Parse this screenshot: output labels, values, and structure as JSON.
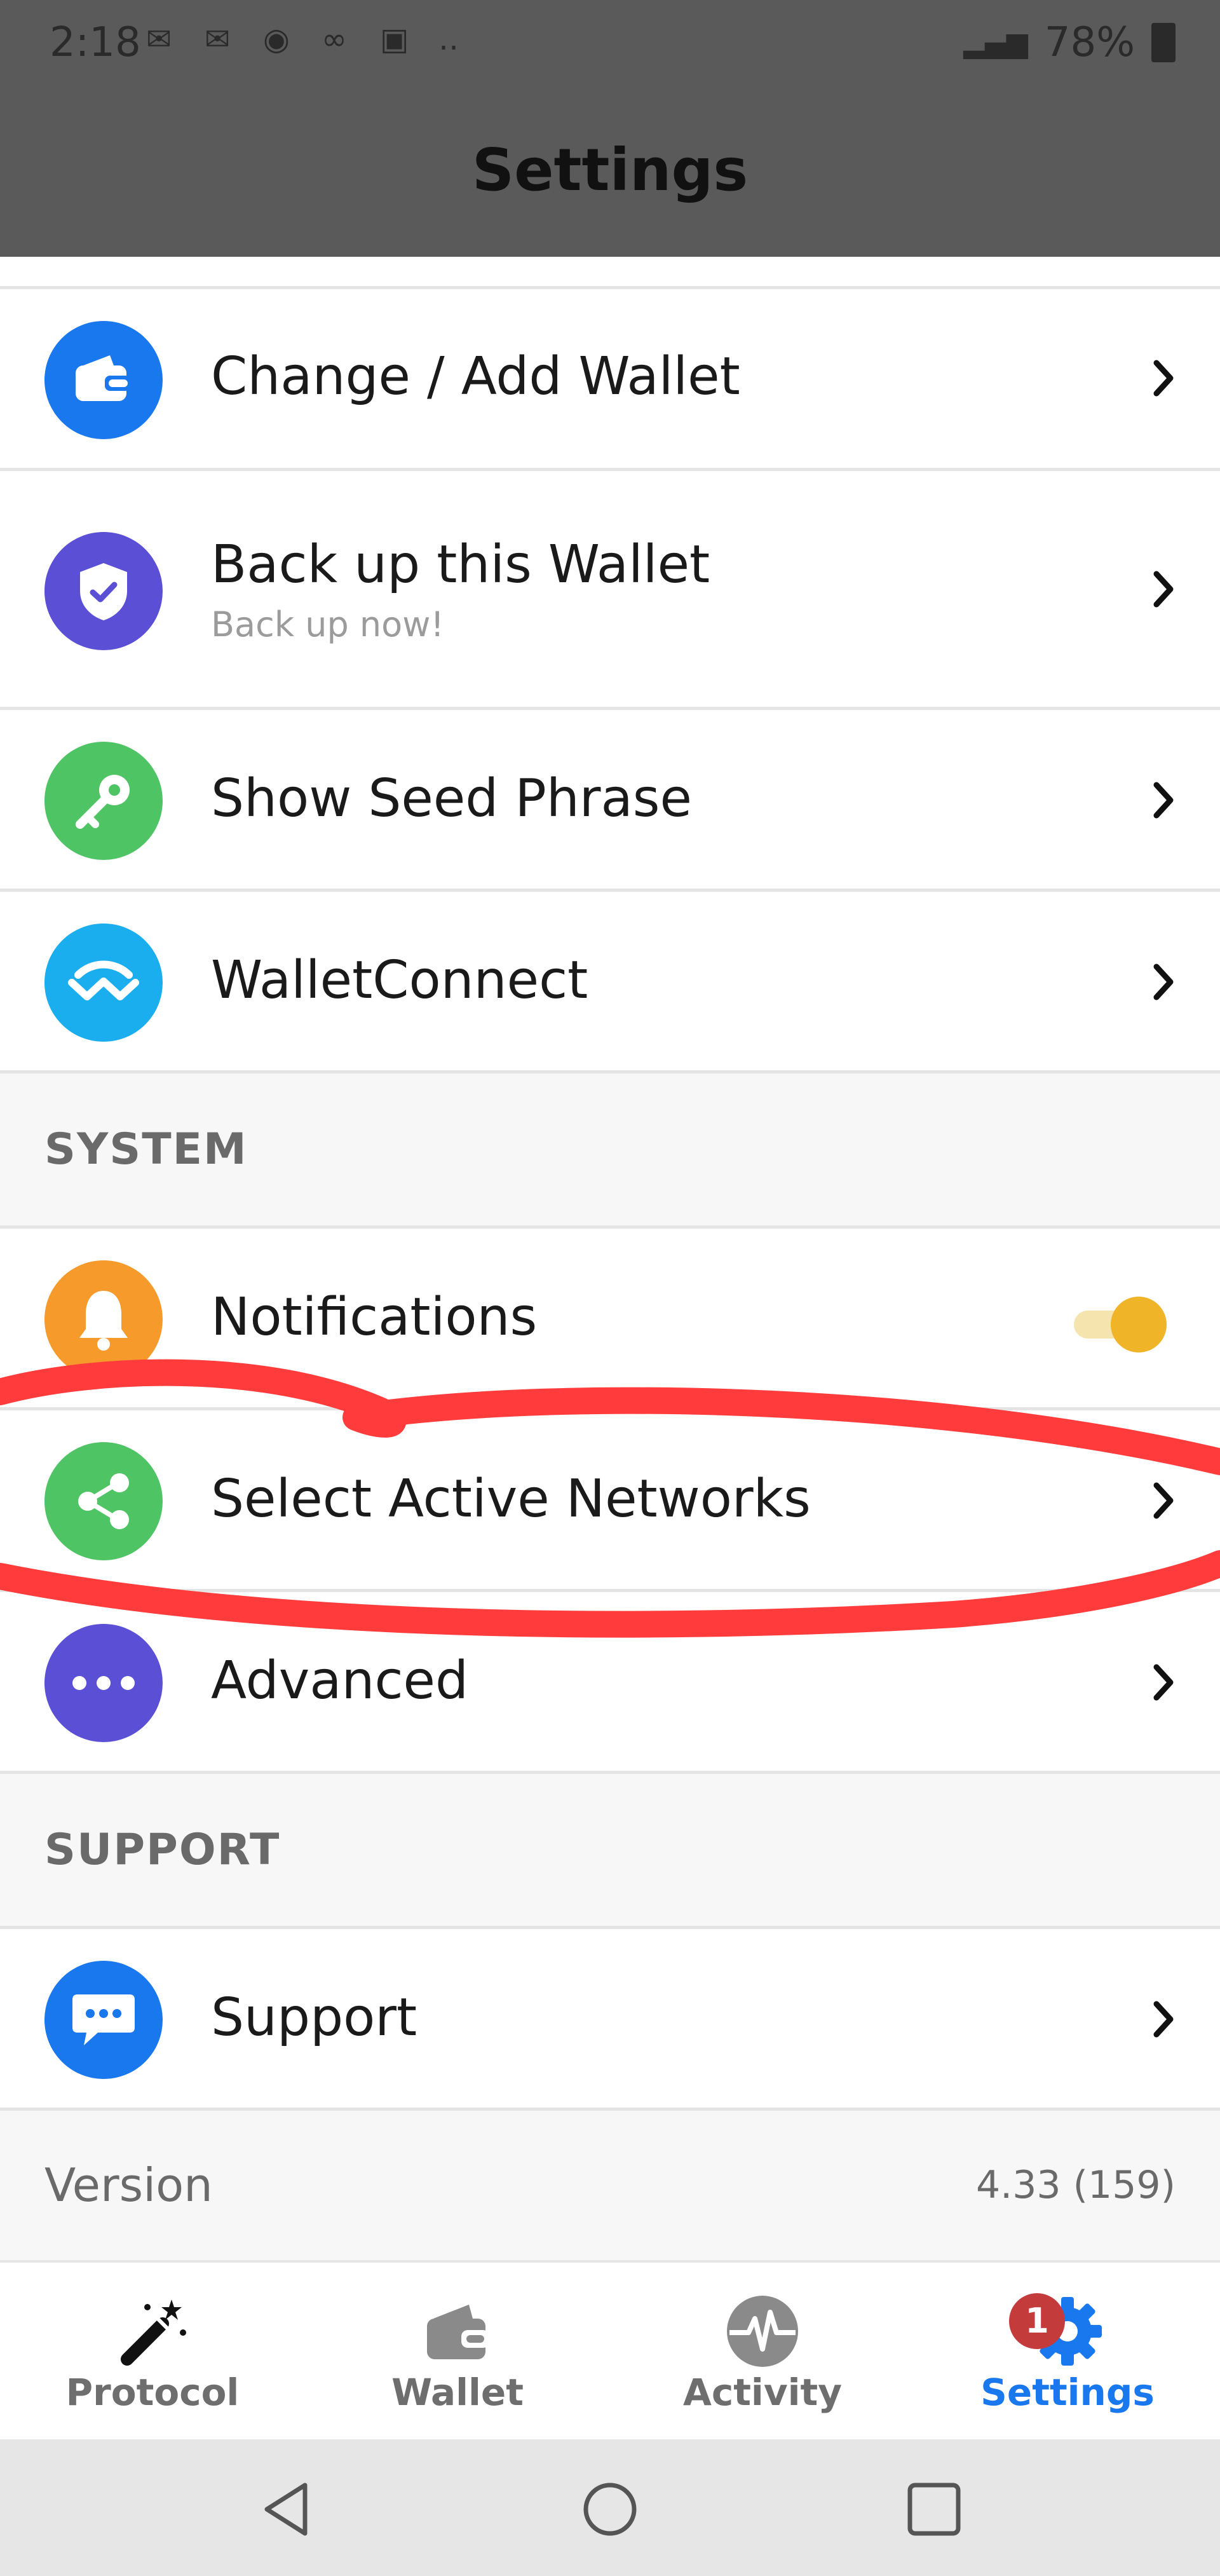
{
  "status_bar": {
    "time": "2:18",
    "battery": "78%"
  },
  "header": {
    "title": "Settings"
  },
  "wallet_items": [
    {
      "label": "Change / Add Wallet",
      "icon": "wallet-icon",
      "color": "#1a78ee"
    },
    {
      "label": "Back up this Wallet",
      "sublabel": "Back up now!",
      "icon": "shield-check-icon",
      "color": "#5b4fd6"
    },
    {
      "label": "Show Seed Phrase",
      "icon": "key-icon",
      "color": "#4ec464"
    },
    {
      "label": "WalletConnect",
      "icon": "walletconnect-icon",
      "color": "#1aaeef"
    }
  ],
  "system": {
    "header": "SYSTEM",
    "items": [
      {
        "label": "Notifications",
        "icon": "bell-icon",
        "color": "#f59a2b",
        "toggle_on": true
      },
      {
        "label": "Select Active Networks",
        "icon": "share-network-icon",
        "color": "#4ec464"
      },
      {
        "label": "Advanced",
        "icon": "more-dots-icon",
        "color": "#5b4fd6"
      }
    ]
  },
  "support": {
    "header": "SUPPORT",
    "items": [
      {
        "label": "Support",
        "icon": "chat-bubble-icon",
        "color": "#1a78ee"
      }
    ]
  },
  "version": {
    "label": "Version",
    "value": "4.33 (159)"
  },
  "tabs": [
    {
      "label": "Protocol",
      "icon": "magic-wand-icon",
      "active": false
    },
    {
      "label": "Wallet",
      "icon": "wallet-icon",
      "active": false
    },
    {
      "label": "Activity",
      "icon": "activity-pulse-icon",
      "active": false
    },
    {
      "label": "Settings",
      "icon": "gear-icon",
      "active": true,
      "badge": "1"
    }
  ],
  "colors": {
    "accent": "#1a78ee",
    "toggle": "#f0b429",
    "annotation": "#ff3b3b",
    "header_bg": "#5a5a5a"
  }
}
